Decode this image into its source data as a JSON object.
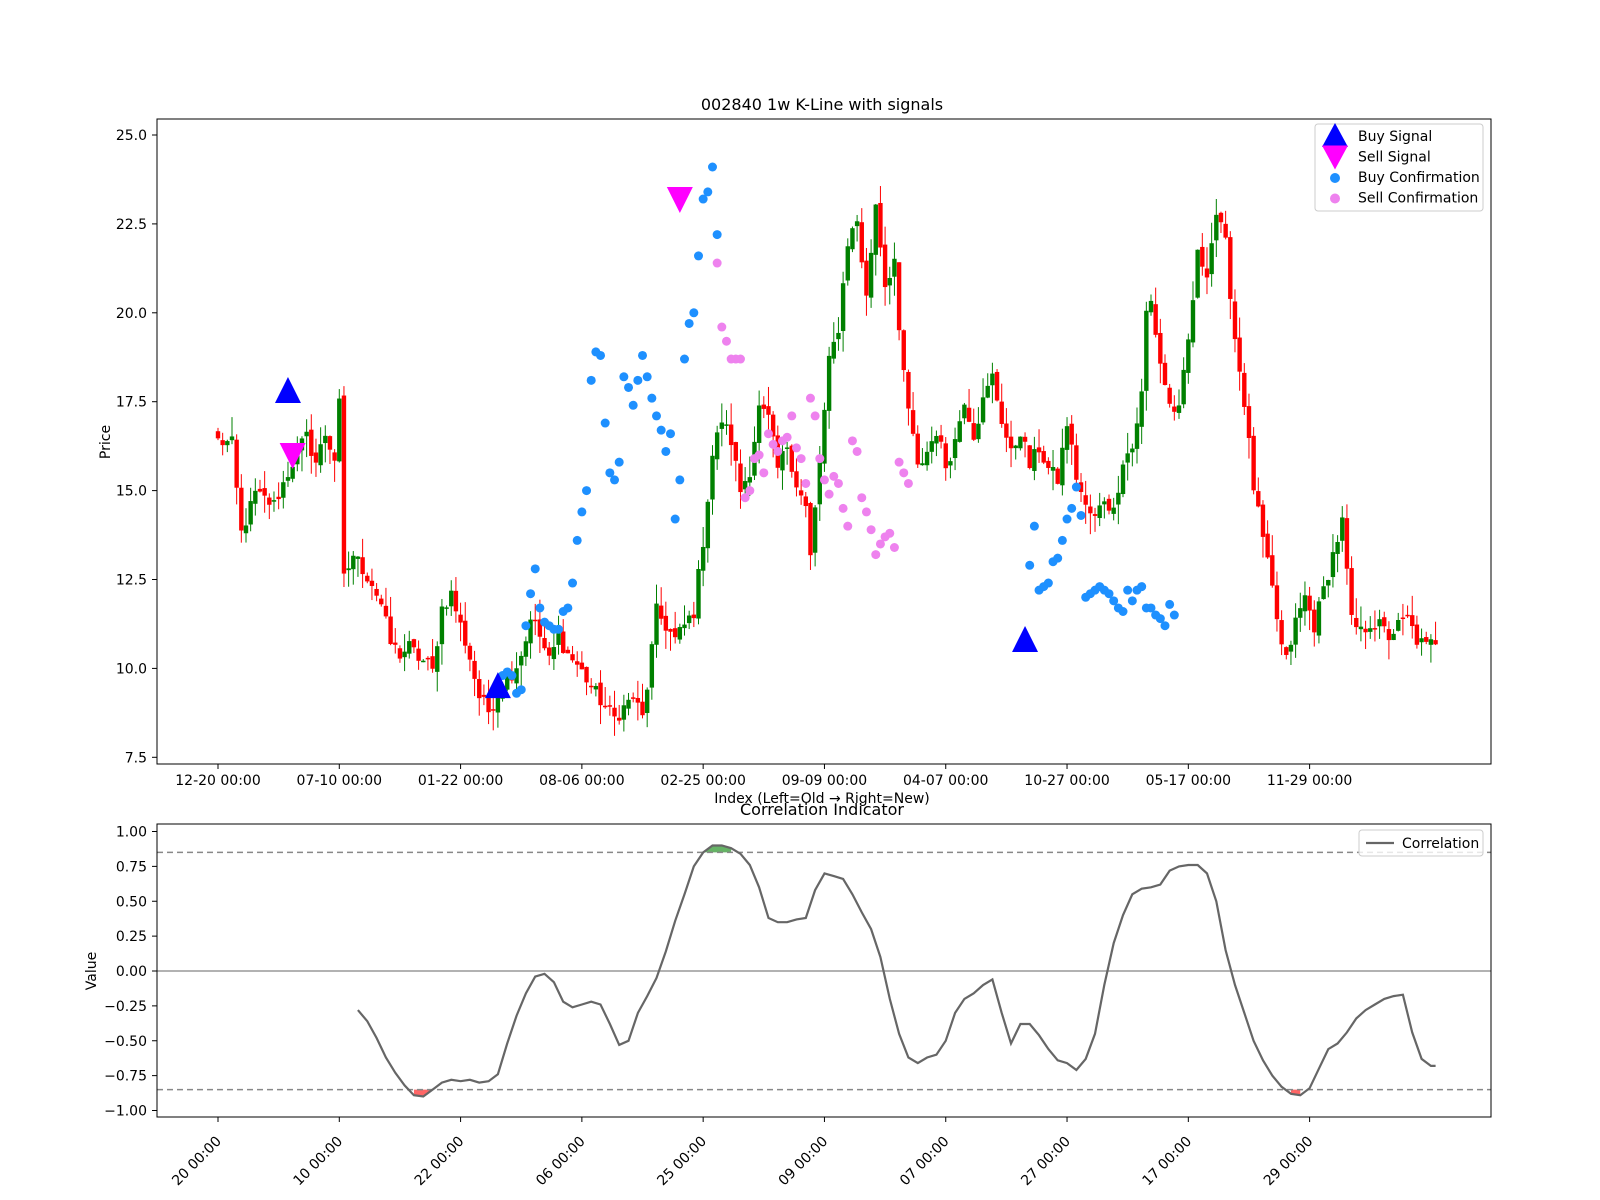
{
  "chart_data": [
    {
      "type": "candlestick",
      "title": "002840 1w K-Line with signals",
      "xlabel": "Index (Left=Old → Right=New)",
      "ylabel": "Price",
      "ylim": [
        7.4,
        25.5
      ],
      "yticks": [
        "7.5",
        "10.0",
        "12.5",
        "15.0",
        "17.5",
        "20.0",
        "22.5",
        "25.0"
      ],
      "xticks": [
        "12-20 00:00",
        "07-10 00:00",
        "01-22 00:00",
        "08-06 00:00",
        "02-25 00:00",
        "09-09 00:00",
        "04-07 00:00",
        "10-27 00:00",
        "05-17 00:00",
        "11-29 00:00"
      ],
      "n_bars": 200,
      "up_color": "#008000",
      "down_color": "#ff0000",
      "close_path": [
        [
          0,
          16.4
        ],
        [
          3,
          16.3
        ],
        [
          4,
          15.0
        ],
        [
          5,
          13.8
        ],
        [
          8,
          14.9
        ],
        [
          12,
          14.6
        ],
        [
          17,
          16.1
        ],
        [
          19,
          16.5
        ],
        [
          21,
          15.8
        ],
        [
          23,
          16.6
        ],
        [
          25,
          15.9
        ],
        [
          26,
          17.4
        ],
        [
          27,
          12.5
        ],
        [
          29,
          13.2
        ],
        [
          31,
          12.8
        ],
        [
          33,
          12.4
        ],
        [
          35,
          11.8
        ],
        [
          37,
          10.7
        ],
        [
          39,
          10.4
        ],
        [
          41,
          10.6
        ],
        [
          43,
          10.3
        ],
        [
          45,
          10.1
        ],
        [
          46,
          9.9
        ],
        [
          48,
          11.7
        ],
        [
          50,
          12.1
        ],
        [
          52,
          11.2
        ],
        [
          54,
          10.3
        ],
        [
          56,
          9.2
        ],
        [
          58,
          8.8
        ],
        [
          60,
          9.3
        ],
        [
          62,
          9.7
        ],
        [
          64,
          10.1
        ],
        [
          66,
          10.8
        ],
        [
          67,
          11.5
        ],
        [
          69,
          10.9
        ],
        [
          71,
          10.2
        ],
        [
          73,
          10.9
        ],
        [
          75,
          10.4
        ],
        [
          77,
          10.1
        ],
        [
          79,
          9.7
        ],
        [
          81,
          9.3
        ],
        [
          83,
          8.9
        ],
        [
          85,
          8.6
        ],
        [
          87,
          8.9
        ],
        [
          89,
          9.2
        ],
        [
          91,
          8.6
        ],
        [
          92,
          9.5
        ],
        [
          94,
          11.6
        ],
        [
          96,
          11.2
        ],
        [
          98,
          10.8
        ],
        [
          100,
          11.2
        ],
        [
          102,
          11.6
        ],
        [
          104,
          13.6
        ],
        [
          106,
          16.0
        ],
        [
          108,
          17.0
        ],
        [
          110,
          16.4
        ],
        [
          112,
          15.0
        ],
        [
          114,
          15.6
        ],
        [
          116,
          17.3
        ],
        [
          118,
          17.0
        ],
        [
          120,
          15.6
        ],
        [
          122,
          16.3
        ],
        [
          124,
          15.2
        ],
        [
          126,
          14.5
        ],
        [
          127,
          13.1
        ],
        [
          129,
          15.8
        ],
        [
          131,
          18.6
        ],
        [
          133,
          19.6
        ],
        [
          135,
          22.0
        ],
        [
          137,
          22.6
        ],
        [
          139,
          20.4
        ],
        [
          141,
          23.1
        ],
        [
          143,
          20.8
        ],
        [
          145,
          21.5
        ],
        [
          146,
          19.3
        ],
        [
          148,
          17.3
        ],
        [
          150,
          15.6
        ],
        [
          152,
          16.1
        ],
        [
          154,
          16.7
        ],
        [
          156,
          15.7
        ],
        [
          158,
          16.4
        ],
        [
          160,
          17.6
        ],
        [
          162,
          16.6
        ],
        [
          164,
          17.5
        ],
        [
          166,
          18.2
        ],
        [
          168,
          17.0
        ],
        [
          170,
          16.0
        ],
        [
          172,
          16.7
        ],
        [
          174,
          15.7
        ],
        [
          176,
          16.2
        ],
        [
          178,
          15.6
        ],
        [
          180,
          15.3
        ],
        [
          182,
          16.9
        ],
        [
          184,
          15.4
        ],
        [
          186,
          14.5
        ],
        [
          188,
          14.2
        ],
        [
          190,
          14.8
        ],
        [
          192,
          14.4
        ],
        [
          194,
          15.9
        ],
        [
          196,
          16.2
        ],
        [
          198,
          17.7
        ],
        [
          199,
          20.0
        ]
      ],
      "close_path_continued": [
        [
          200,
          20.3
        ],
        [
          202,
          18.6
        ],
        [
          204,
          17.4
        ],
        [
          206,
          17.2
        ],
        [
          208,
          19.2
        ],
        [
          210,
          21.6
        ],
        [
          212,
          21.2
        ],
        [
          214,
          22.8
        ],
        [
          216,
          21.9
        ],
        [
          218,
          19.3
        ],
        [
          220,
          17.5
        ],
        [
          222,
          15.1
        ],
        [
          224,
          13.6
        ],
        [
          226,
          12.2
        ],
        [
          228,
          10.6
        ],
        [
          229,
          10.2
        ],
        [
          231,
          11.3
        ],
        [
          233,
          12.0
        ],
        [
          235,
          11.2
        ],
        [
          237,
          12.2
        ],
        [
          239,
          13.2
        ],
        [
          241,
          14.1
        ],
        [
          243,
          11.3
        ],
        [
          245,
          11.0
        ],
        [
          247,
          11.3
        ],
        [
          249,
          11.2
        ],
        [
          251,
          10.9
        ],
        [
          253,
          11.2
        ],
        [
          255,
          11.4
        ],
        [
          257,
          10.8
        ],
        [
          259,
          10.6
        ],
        [
          261,
          10.8
        ]
      ],
      "buy_signals": [
        [
          15,
          17.8
        ],
        [
          60,
          9.5
        ],
        [
          173,
          10.8
        ]
      ],
      "sell_signals": [
        [
          16,
          16.0
        ],
        [
          99,
          23.2
        ]
      ],
      "buy_confirmations": [
        [
          60,
          9.6
        ],
        [
          61,
          9.8
        ],
        [
          62,
          9.9
        ],
        [
          63,
          9.8
        ],
        [
          64,
          9.3
        ],
        [
          65,
          9.4
        ],
        [
          66,
          11.2
        ],
        [
          67,
          12.1
        ],
        [
          68,
          12.8
        ],
        [
          69,
          11.7
        ],
        [
          70,
          11.3
        ],
        [
          71,
          11.2
        ],
        [
          72,
          11.1
        ],
        [
          73,
          11.1
        ],
        [
          74,
          11.6
        ],
        [
          75,
          11.7
        ],
        [
          76,
          12.4
        ],
        [
          77,
          13.6
        ],
        [
          78,
          14.4
        ],
        [
          79,
          15.0
        ],
        [
          80,
          18.1
        ],
        [
          81,
          18.9
        ],
        [
          82,
          18.8
        ],
        [
          83,
          16.9
        ],
        [
          84,
          15.5
        ],
        [
          85,
          15.3
        ],
        [
          86,
          15.8
        ],
        [
          87,
          18.2
        ],
        [
          88,
          17.9
        ],
        [
          89,
          17.4
        ],
        [
          90,
          18.1
        ],
        [
          91,
          18.8
        ],
        [
          92,
          18.2
        ],
        [
          93,
          17.6
        ],
        [
          94,
          17.1
        ],
        [
          95,
          16.7
        ],
        [
          96,
          16.1
        ],
        [
          97,
          16.6
        ],
        [
          98,
          14.2
        ],
        [
          99,
          15.3
        ],
        [
          100,
          18.7
        ],
        [
          101,
          19.7
        ],
        [
          102,
          20.0
        ],
        [
          103,
          21.6
        ],
        [
          104,
          23.2
        ],
        [
          105,
          23.4
        ],
        [
          106,
          24.1
        ],
        [
          107,
          22.2
        ],
        [
          174,
          12.9
        ],
        [
          175,
          14.0
        ],
        [
          176,
          12.2
        ],
        [
          177,
          12.3
        ],
        [
          178,
          12.4
        ],
        [
          179,
          13.0
        ],
        [
          180,
          13.1
        ],
        [
          181,
          13.6
        ],
        [
          182,
          14.2
        ],
        [
          183,
          14.5
        ],
        [
          184,
          15.1
        ],
        [
          185,
          14.3
        ],
        [
          186,
          12.0
        ],
        [
          187,
          12.1
        ],
        [
          188,
          12.2
        ],
        [
          189,
          12.3
        ],
        [
          190,
          12.2
        ],
        [
          191,
          12.1
        ],
        [
          192,
          11.9
        ],
        [
          193,
          11.7
        ],
        [
          194,
          11.6
        ],
        [
          195,
          12.2
        ],
        [
          196,
          11.9
        ],
        [
          197,
          12.2
        ],
        [
          198,
          12.3
        ],
        [
          199,
          11.7
        ],
        [
          200,
          11.7
        ],
        [
          201,
          11.5
        ],
        [
          202,
          11.4
        ],
        [
          203,
          11.2
        ],
        [
          204,
          11.8
        ],
        [
          205,
          11.5
        ]
      ],
      "sell_confirmations": [
        [
          107,
          21.4
        ],
        [
          108,
          19.6
        ],
        [
          109,
          19.2
        ],
        [
          110,
          18.7
        ],
        [
          111,
          18.7
        ],
        [
          112,
          18.7
        ],
        [
          113,
          14.8
        ],
        [
          114,
          15.0
        ],
        [
          115,
          15.9
        ],
        [
          116,
          16.0
        ],
        [
          117,
          15.5
        ],
        [
          118,
          16.6
        ],
        [
          119,
          16.3
        ],
        [
          120,
          16.1
        ],
        [
          121,
          16.4
        ],
        [
          122,
          16.5
        ],
        [
          123,
          17.1
        ],
        [
          124,
          16.2
        ],
        [
          125,
          15.9
        ],
        [
          126,
          15.2
        ],
        [
          127,
          17.6
        ],
        [
          128,
          17.1
        ],
        [
          129,
          15.9
        ],
        [
          130,
          15.3
        ],
        [
          131,
          14.9
        ],
        [
          132,
          15.4
        ],
        [
          133,
          15.2
        ],
        [
          134,
          14.5
        ],
        [
          135,
          14.0
        ],
        [
          136,
          16.4
        ],
        [
          137,
          16.1
        ],
        [
          138,
          14.8
        ],
        [
          139,
          14.4
        ],
        [
          140,
          13.9
        ],
        [
          141,
          13.2
        ],
        [
          142,
          13.5
        ],
        [
          143,
          13.7
        ],
        [
          144,
          13.8
        ],
        [
          145,
          13.4
        ],
        [
          146,
          15.8
        ],
        [
          147,
          15.5
        ],
        [
          148,
          15.2
        ]
      ],
      "legend": [
        {
          "label": "Buy Signal",
          "marker": "triangle-up",
          "color": "#0000ff"
        },
        {
          "label": "Sell Signal",
          "marker": "triangle-down",
          "color": "#ff00ff"
        },
        {
          "label": "Buy Confirmation",
          "marker": "circle",
          "color": "#1e90ff"
        },
        {
          "label": "Sell Confirmation",
          "marker": "circle",
          "color": "#ee82ee"
        }
      ],
      "legend_position": "top-right"
    },
    {
      "type": "line",
      "title": "Correlation Indicator",
      "ylabel": "Value",
      "ylim": [
        -1.05,
        1.05
      ],
      "yticks": [
        "−1.00",
        "−0.75",
        "−0.50",
        "−0.25",
        "0.00",
        "0.25",
        "0.50",
        "0.75",
        "1.00"
      ],
      "xticks": [
        "20 00:00",
        "10 00:00",
        "22 00:00",
        "06 00:00",
        "25 00:00",
        "09 00:00",
        "07 00:00",
        "27 00:00",
        "17 00:00",
        "29 00:00"
      ],
      "thresholds": [
        0.85,
        -0.85
      ],
      "zero_line": 0,
      "line_color": "#666666",
      "upper_fill_color": "#008000",
      "lower_fill_color": "#ff0000",
      "series": [
        {
          "name": "Correlation",
          "x": [
            30,
            32,
            34,
            36,
            38,
            40,
            42,
            44,
            46,
            48,
            50,
            52,
            54,
            56,
            58,
            60,
            62,
            64,
            66,
            68,
            70,
            72,
            74,
            76,
            78,
            80,
            82,
            84,
            86,
            88,
            90,
            92,
            94,
            96,
            98,
            100,
            102,
            104,
            106,
            108,
            110,
            112,
            114,
            116,
            118,
            120,
            122,
            124,
            126,
            128,
            130,
            132,
            134,
            136,
            138,
            140,
            142,
            144,
            146,
            148,
            150,
            152,
            154,
            156,
            158,
            160,
            162,
            164,
            166,
            168,
            170,
            172,
            174,
            176,
            178,
            180,
            182,
            184,
            186,
            188,
            190,
            192,
            194,
            196,
            198,
            200,
            202,
            204,
            206,
            208,
            210,
            212,
            214,
            216,
            218,
            220,
            222,
            224,
            226,
            228,
            230,
            232,
            234,
            236,
            238,
            240,
            242,
            244,
            246,
            248,
            250,
            252,
            254,
            256,
            258,
            260,
            261
          ],
          "values": [
            -0.28,
            -0.36,
            -0.48,
            -0.62,
            -0.73,
            -0.82,
            -0.89,
            -0.9,
            -0.85,
            -0.8,
            -0.78,
            -0.79,
            -0.78,
            -0.8,
            -0.79,
            -0.74,
            -0.52,
            -0.32,
            -0.16,
            -0.04,
            -0.02,
            -0.08,
            -0.22,
            -0.26,
            -0.24,
            -0.22,
            -0.24,
            -0.38,
            -0.53,
            -0.5,
            -0.3,
            -0.18,
            -0.05,
            0.14,
            0.36,
            0.55,
            0.75,
            0.85,
            0.9,
            0.9,
            0.88,
            0.84,
            0.76,
            0.6,
            0.38,
            0.35,
            0.35,
            0.37,
            0.38,
            0.58,
            0.7,
            0.68,
            0.66,
            0.55,
            0.42,
            0.3,
            0.1,
            -0.2,
            -0.45,
            -0.62,
            -0.66,
            -0.62,
            -0.6,
            -0.5,
            -0.3,
            -0.2,
            -0.16,
            -0.1,
            -0.06,
            -0.3,
            -0.52,
            -0.38,
            -0.38,
            -0.46,
            -0.56,
            -0.64,
            -0.66,
            -0.71,
            -0.63,
            -0.45,
            -0.1,
            0.2,
            0.4,
            0.55,
            0.59,
            0.6,
            0.62,
            0.72,
            0.75,
            0.76,
            0.76,
            0.7,
            0.5,
            0.15,
            -0.1,
            -0.3,
            -0.5,
            -0.64,
            -0.75,
            -0.83,
            -0.88,
            -0.89,
            -0.84,
            -0.7,
            -0.56,
            -0.52,
            -0.44,
            -0.34,
            -0.28,
            -0.24,
            -0.2,
            -0.18,
            -0.17,
            -0.44,
            -0.63,
            -0.68,
            -0.68
          ]
        }
      ],
      "legend_position": "top-right"
    }
  ]
}
